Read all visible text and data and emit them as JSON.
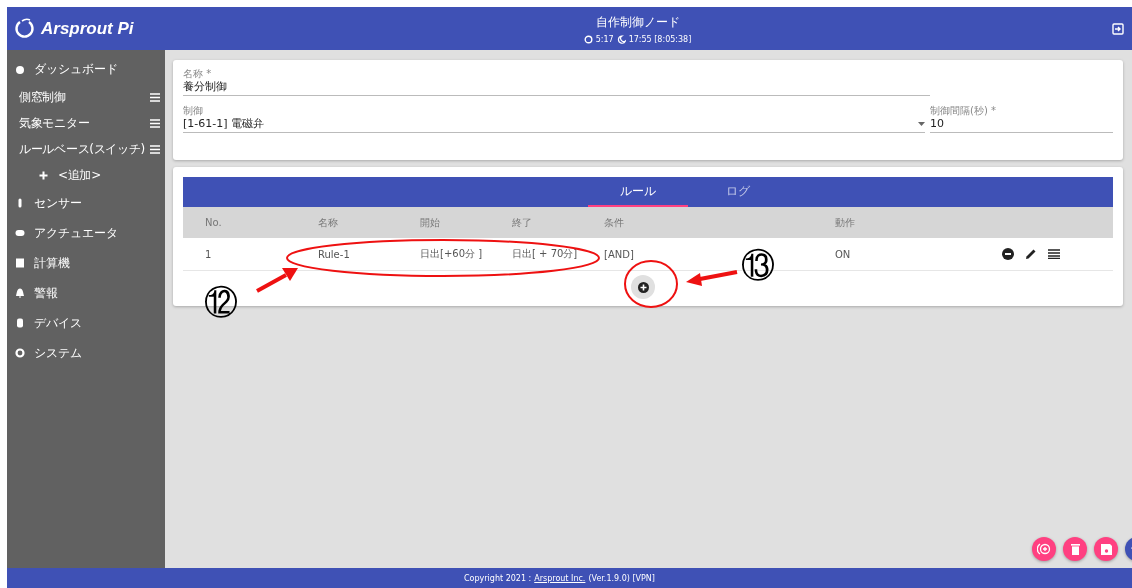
{
  "header": {
    "logo": "Arsprout Pi",
    "title": "自作制御ノード",
    "sunrise": "5:17",
    "sunset": "17:55 [8:05:38]"
  },
  "sidebar": {
    "items": [
      {
        "label": "ダッシュボード",
        "children": [
          {
            "label": "側窓制御",
            "kind": "page"
          },
          {
            "label": "気象モニター",
            "kind": "page"
          },
          {
            "label": "ルールベース(スイッチ)",
            "kind": "page"
          },
          {
            "label": "<追加>",
            "kind": "add"
          }
        ]
      },
      {
        "label": "センサー"
      },
      {
        "label": "アクチュエータ"
      },
      {
        "label": "計算機"
      },
      {
        "label": "警報"
      },
      {
        "label": "デバイス"
      },
      {
        "label": "システム"
      }
    ]
  },
  "form": {
    "name": {
      "label": "名称 *",
      "value": "養分制御"
    },
    "control": {
      "label": "制御",
      "value": "[1-61-1] 電磁弁"
    },
    "interval": {
      "label": "制御間隔(秒) *",
      "value": "10"
    }
  },
  "tabs": [
    {
      "label": "ルール",
      "selected": true
    },
    {
      "label": "ログ",
      "selected": false
    }
  ],
  "table": {
    "columns": [
      "No.",
      "名称",
      "開始",
      "終了",
      "条件",
      "動作"
    ],
    "rows": [
      [
        "1",
        "Rule-1",
        "日出[+60分 ]",
        "日出[ + 70分]",
        "[AND]",
        "ON"
      ]
    ]
  },
  "annotations": [
    {
      "label": "⑫"
    },
    {
      "label": "⑬"
    }
  ],
  "footer": {
    "copyright": "Copyright 2021 :",
    "link": "Arsprout Inc.",
    "version": "(Ver.1.9.0) [VPN]"
  }
}
